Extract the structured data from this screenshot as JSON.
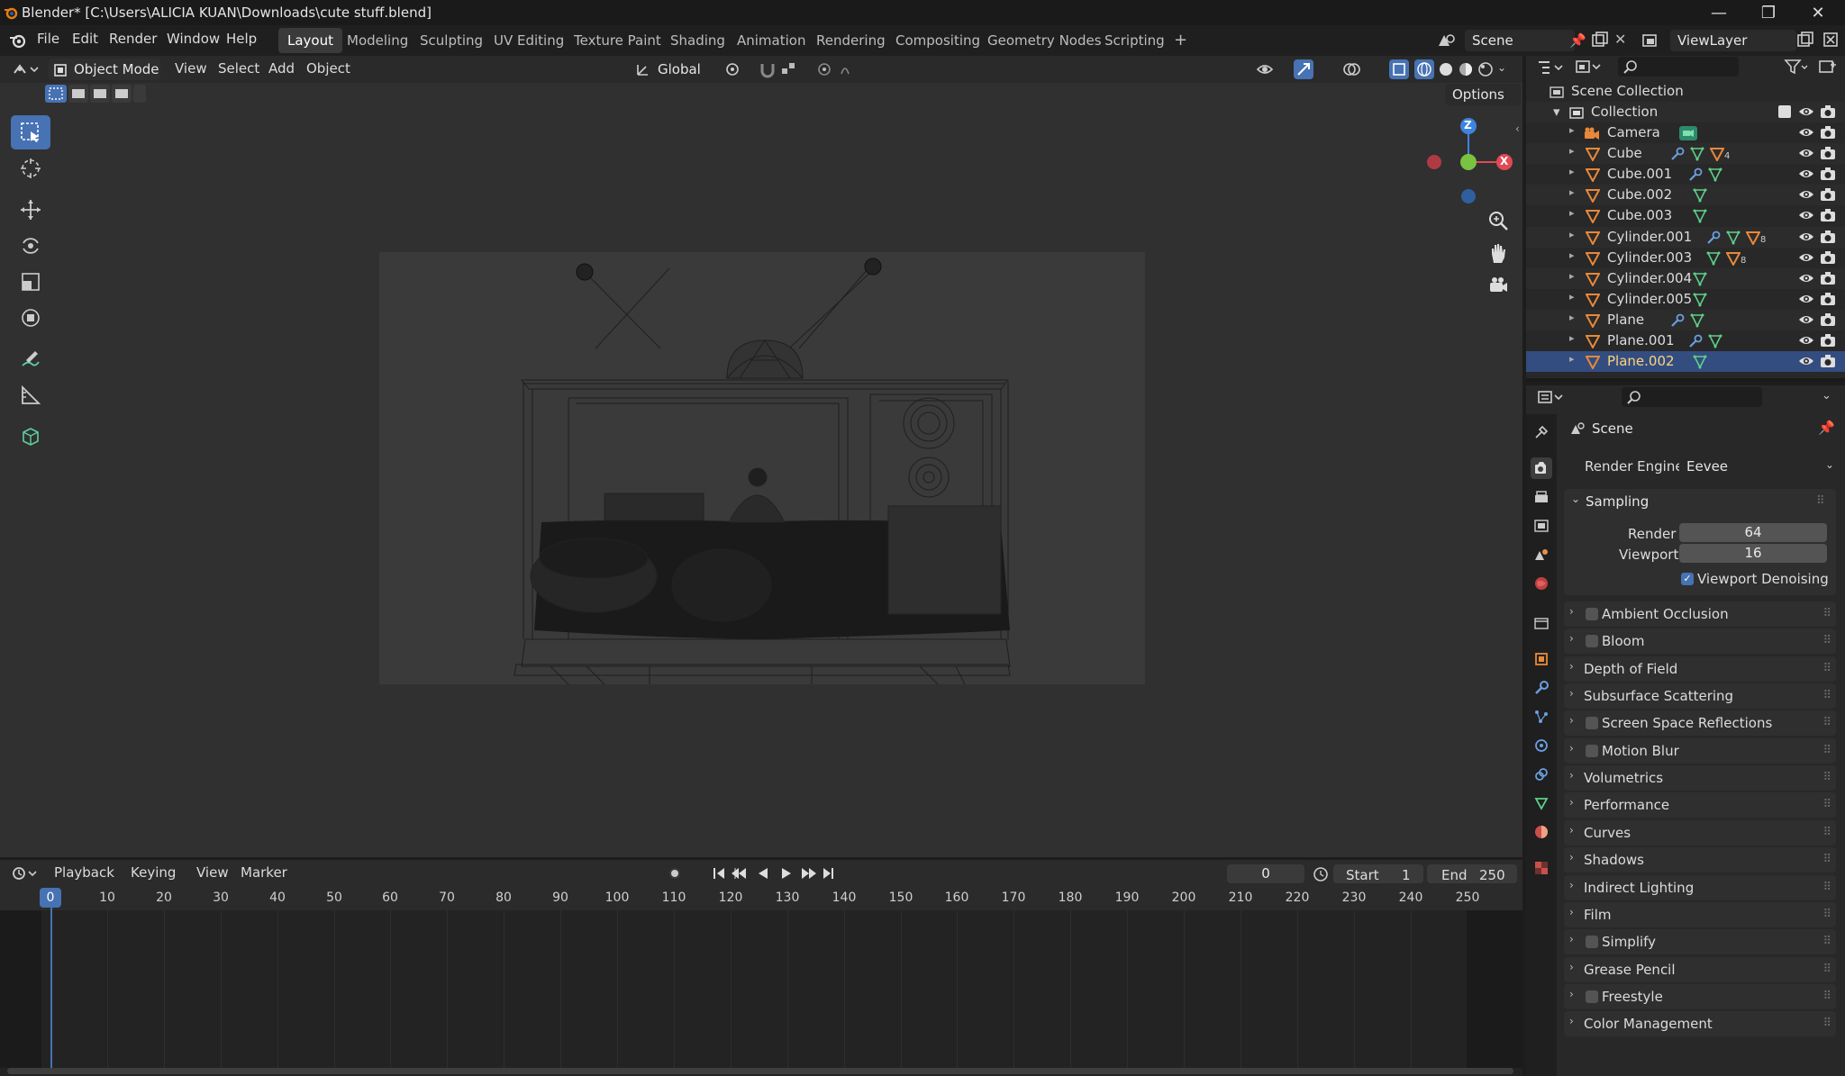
{
  "window": {
    "title": "Blender* [C:\\Users\\ALICIA KUAN\\Downloads\\cute stuff.blend]",
    "minimize_icon": "minimize-icon",
    "maximize_icon": "maximize-icon",
    "close_icon": "close-icon"
  },
  "menubar": {
    "items": [
      "File",
      "Edit",
      "Render",
      "Window",
      "Help"
    ]
  },
  "workspaces": {
    "tabs": [
      "Layout",
      "Modeling",
      "Sculpting",
      "UV Editing",
      "Texture Paint",
      "Shading",
      "Animation",
      "Rendering",
      "Compositing",
      "Geometry Nodes",
      "Scripting"
    ],
    "active": "Layout",
    "add_label": "+"
  },
  "scene": {
    "label": "Scene"
  },
  "view_layer": {
    "label": "ViewLayer"
  },
  "viewport": {
    "mode": "Object Mode",
    "menus": [
      "View",
      "Select",
      "Add",
      "Object"
    ],
    "transform_orientation": "Global",
    "options_label": "Options",
    "gizmo": {
      "x": "X",
      "y": "Y",
      "z": "Z"
    }
  },
  "timeline": {
    "menus": [
      "Playback",
      "Keying",
      "View",
      "Marker"
    ],
    "current_frame": "0",
    "start_label": "Start",
    "start_value": "1",
    "end_label": "End",
    "end_value": "250",
    "ticks": [
      "0",
      "10",
      "20",
      "30",
      "40",
      "50",
      "60",
      "70",
      "80",
      "90",
      "100",
      "110",
      "120",
      "130",
      "140",
      "150",
      "160",
      "170",
      "180",
      "190",
      "200",
      "210",
      "220",
      "230",
      "240",
      "250"
    ]
  },
  "outliner": {
    "root": "Scene Collection",
    "collection": "Collection",
    "items": [
      {
        "name": "Camera"
      },
      {
        "name": "Cube"
      },
      {
        "name": "Cube.001"
      },
      {
        "name": "Cube.002"
      },
      {
        "name": "Cube.003"
      },
      {
        "name": "Cylinder.001"
      },
      {
        "name": "Cylinder.003"
      },
      {
        "name": "Cylinder.004"
      },
      {
        "name": "Cylinder.005"
      },
      {
        "name": "Plane"
      },
      {
        "name": "Plane.001"
      },
      {
        "name": "Plane.002"
      }
    ],
    "selected": "Plane.002",
    "badges": {
      "cube": "4",
      "cyl1": "8",
      "cyl3": "8"
    }
  },
  "properties": {
    "context": "Scene",
    "render_engine_label": "Render Engine",
    "render_engine": "Eevee",
    "sampling": {
      "title": "Sampling",
      "render_label": "Render",
      "render_value": "64",
      "viewport_label": "Viewport",
      "viewport_value": "16",
      "denoise_label": "Viewport Denoising",
      "denoise_checked": true
    },
    "panels": [
      {
        "label": "Ambient Occlusion",
        "checkbox": true
      },
      {
        "label": "Bloom",
        "checkbox": true
      },
      {
        "label": "Depth of Field",
        "checkbox": false
      },
      {
        "label": "Subsurface Scattering",
        "checkbox": false
      },
      {
        "label": "Screen Space Reflections",
        "checkbox": true
      },
      {
        "label": "Motion Blur",
        "checkbox": true
      },
      {
        "label": "Volumetrics",
        "checkbox": false
      },
      {
        "label": "Performance",
        "checkbox": false
      },
      {
        "label": "Curves",
        "checkbox": false
      },
      {
        "label": "Shadows",
        "checkbox": false
      },
      {
        "label": "Indirect Lighting",
        "checkbox": false
      },
      {
        "label": "Film",
        "checkbox": false
      },
      {
        "label": "Simplify",
        "checkbox": true
      },
      {
        "label": "Grease Pencil",
        "checkbox": false
      },
      {
        "label": "Freestyle",
        "checkbox": true
      },
      {
        "label": "Color Management",
        "checkbox": false
      }
    ]
  },
  "colors": {
    "accent": "#4772b3",
    "selection": "#334d80",
    "object_orange": "#e8883a",
    "mesh_green": "#5fd08a",
    "modifier_blue": "#6a9fe0",
    "axis_x": "#e04955",
    "axis_y": "#7ac240",
    "axis_z": "#3d84e0"
  }
}
